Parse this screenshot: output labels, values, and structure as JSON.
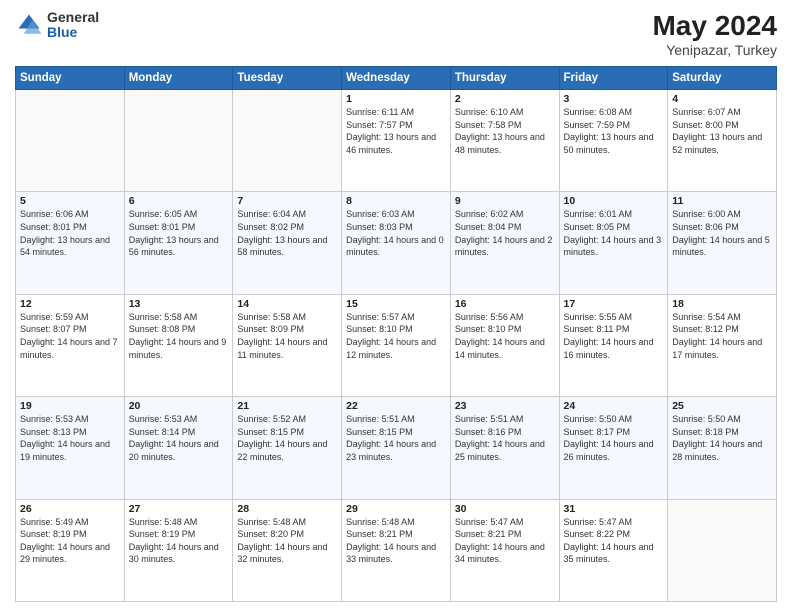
{
  "header": {
    "logo_general": "General",
    "logo_blue": "Blue",
    "title": "May 2024",
    "location": "Yenipazar, Turkey"
  },
  "weekdays": [
    "Sunday",
    "Monday",
    "Tuesday",
    "Wednesday",
    "Thursday",
    "Friday",
    "Saturday"
  ],
  "weeks": [
    [
      {
        "day": "",
        "info": ""
      },
      {
        "day": "",
        "info": ""
      },
      {
        "day": "",
        "info": ""
      },
      {
        "day": "1",
        "info": "Sunrise: 6:11 AM\nSunset: 7:57 PM\nDaylight: 13 hours and 46 minutes."
      },
      {
        "day": "2",
        "info": "Sunrise: 6:10 AM\nSunset: 7:58 PM\nDaylight: 13 hours and 48 minutes."
      },
      {
        "day": "3",
        "info": "Sunrise: 6:08 AM\nSunset: 7:59 PM\nDaylight: 13 hours and 50 minutes."
      },
      {
        "day": "4",
        "info": "Sunrise: 6:07 AM\nSunset: 8:00 PM\nDaylight: 13 hours and 52 minutes."
      }
    ],
    [
      {
        "day": "5",
        "info": "Sunrise: 6:06 AM\nSunset: 8:01 PM\nDaylight: 13 hours and 54 minutes."
      },
      {
        "day": "6",
        "info": "Sunrise: 6:05 AM\nSunset: 8:01 PM\nDaylight: 13 hours and 56 minutes."
      },
      {
        "day": "7",
        "info": "Sunrise: 6:04 AM\nSunset: 8:02 PM\nDaylight: 13 hours and 58 minutes."
      },
      {
        "day": "8",
        "info": "Sunrise: 6:03 AM\nSunset: 8:03 PM\nDaylight: 14 hours and 0 minutes."
      },
      {
        "day": "9",
        "info": "Sunrise: 6:02 AM\nSunset: 8:04 PM\nDaylight: 14 hours and 2 minutes."
      },
      {
        "day": "10",
        "info": "Sunrise: 6:01 AM\nSunset: 8:05 PM\nDaylight: 14 hours and 3 minutes."
      },
      {
        "day": "11",
        "info": "Sunrise: 6:00 AM\nSunset: 8:06 PM\nDaylight: 14 hours and 5 minutes."
      }
    ],
    [
      {
        "day": "12",
        "info": "Sunrise: 5:59 AM\nSunset: 8:07 PM\nDaylight: 14 hours and 7 minutes."
      },
      {
        "day": "13",
        "info": "Sunrise: 5:58 AM\nSunset: 8:08 PM\nDaylight: 14 hours and 9 minutes."
      },
      {
        "day": "14",
        "info": "Sunrise: 5:58 AM\nSunset: 8:09 PM\nDaylight: 14 hours and 11 minutes."
      },
      {
        "day": "15",
        "info": "Sunrise: 5:57 AM\nSunset: 8:10 PM\nDaylight: 14 hours and 12 minutes."
      },
      {
        "day": "16",
        "info": "Sunrise: 5:56 AM\nSunset: 8:10 PM\nDaylight: 14 hours and 14 minutes."
      },
      {
        "day": "17",
        "info": "Sunrise: 5:55 AM\nSunset: 8:11 PM\nDaylight: 14 hours and 16 minutes."
      },
      {
        "day": "18",
        "info": "Sunrise: 5:54 AM\nSunset: 8:12 PM\nDaylight: 14 hours and 17 minutes."
      }
    ],
    [
      {
        "day": "19",
        "info": "Sunrise: 5:53 AM\nSunset: 8:13 PM\nDaylight: 14 hours and 19 minutes."
      },
      {
        "day": "20",
        "info": "Sunrise: 5:53 AM\nSunset: 8:14 PM\nDaylight: 14 hours and 20 minutes."
      },
      {
        "day": "21",
        "info": "Sunrise: 5:52 AM\nSunset: 8:15 PM\nDaylight: 14 hours and 22 minutes."
      },
      {
        "day": "22",
        "info": "Sunrise: 5:51 AM\nSunset: 8:15 PM\nDaylight: 14 hours and 23 minutes."
      },
      {
        "day": "23",
        "info": "Sunrise: 5:51 AM\nSunset: 8:16 PM\nDaylight: 14 hours and 25 minutes."
      },
      {
        "day": "24",
        "info": "Sunrise: 5:50 AM\nSunset: 8:17 PM\nDaylight: 14 hours and 26 minutes."
      },
      {
        "day": "25",
        "info": "Sunrise: 5:50 AM\nSunset: 8:18 PM\nDaylight: 14 hours and 28 minutes."
      }
    ],
    [
      {
        "day": "26",
        "info": "Sunrise: 5:49 AM\nSunset: 8:19 PM\nDaylight: 14 hours and 29 minutes."
      },
      {
        "day": "27",
        "info": "Sunrise: 5:48 AM\nSunset: 8:19 PM\nDaylight: 14 hours and 30 minutes."
      },
      {
        "day": "28",
        "info": "Sunrise: 5:48 AM\nSunset: 8:20 PM\nDaylight: 14 hours and 32 minutes."
      },
      {
        "day": "29",
        "info": "Sunrise: 5:48 AM\nSunset: 8:21 PM\nDaylight: 14 hours and 33 minutes."
      },
      {
        "day": "30",
        "info": "Sunrise: 5:47 AM\nSunset: 8:21 PM\nDaylight: 14 hours and 34 minutes."
      },
      {
        "day": "31",
        "info": "Sunrise: 5:47 AM\nSunset: 8:22 PM\nDaylight: 14 hours and 35 minutes."
      },
      {
        "day": "",
        "info": ""
      }
    ]
  ]
}
